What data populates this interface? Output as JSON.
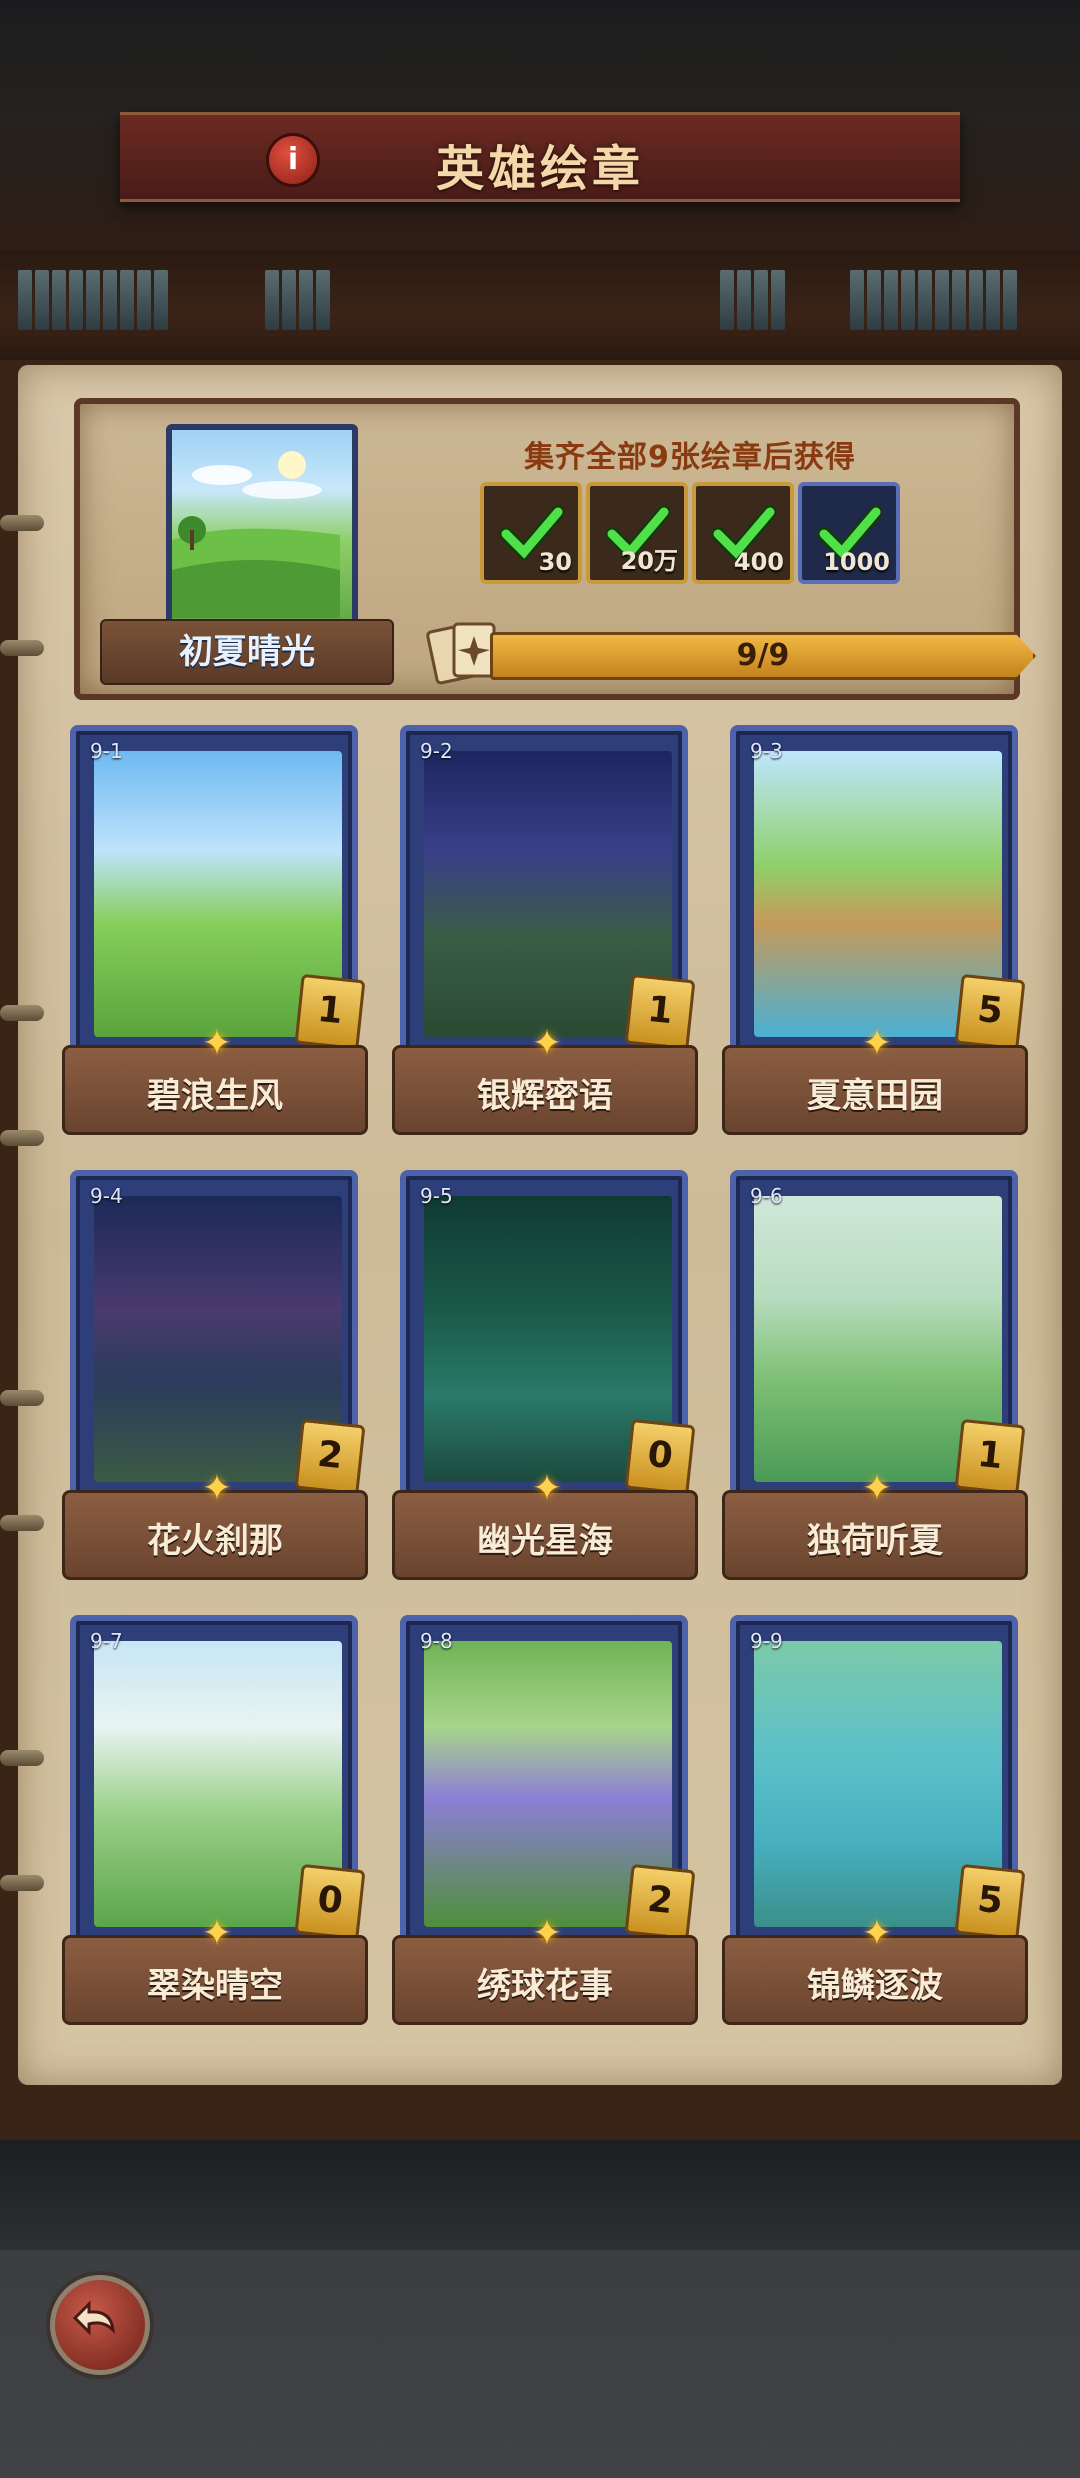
{
  "header": {
    "title": "英雄绘章",
    "info_icon": "info-icon"
  },
  "collection": {
    "cover_name": "初夏晴光",
    "reward_heading": "集齐全部9张绘章后获得",
    "rewards": [
      {
        "amount": "30",
        "icon": "ore-icon",
        "claimed": true
      },
      {
        "amount": "20万",
        "icon": "crystal-icon",
        "claimed": true
      },
      {
        "amount": "400",
        "icon": "stone-icon",
        "claimed": true
      },
      {
        "amount": "1000",
        "icon": "stone-icon",
        "claimed": true
      }
    ],
    "progress": {
      "text": "9/9",
      "value": 1.0
    }
  },
  "cards": [
    {
      "id": "9-1",
      "name": "碧浪生风",
      "count": "1"
    },
    {
      "id": "9-2",
      "name": "银辉密语",
      "count": "1"
    },
    {
      "id": "9-3",
      "name": "夏意田园",
      "count": "5"
    },
    {
      "id": "9-4",
      "name": "花火刹那",
      "count": "2"
    },
    {
      "id": "9-5",
      "name": "幽光星海",
      "count": "0"
    },
    {
      "id": "9-6",
      "name": "独荷听夏",
      "count": "1"
    },
    {
      "id": "9-7",
      "name": "翠染晴空",
      "count": "0"
    },
    {
      "id": "9-8",
      "name": "绣球花事",
      "count": "2"
    },
    {
      "id": "9-9",
      "name": "锦鳞逐波",
      "count": "5"
    }
  ],
  "colors": {
    "progress_fill": "#e0a531",
    "card_frame": "#4d62a8",
    "title_text": "#f3d8a9"
  }
}
